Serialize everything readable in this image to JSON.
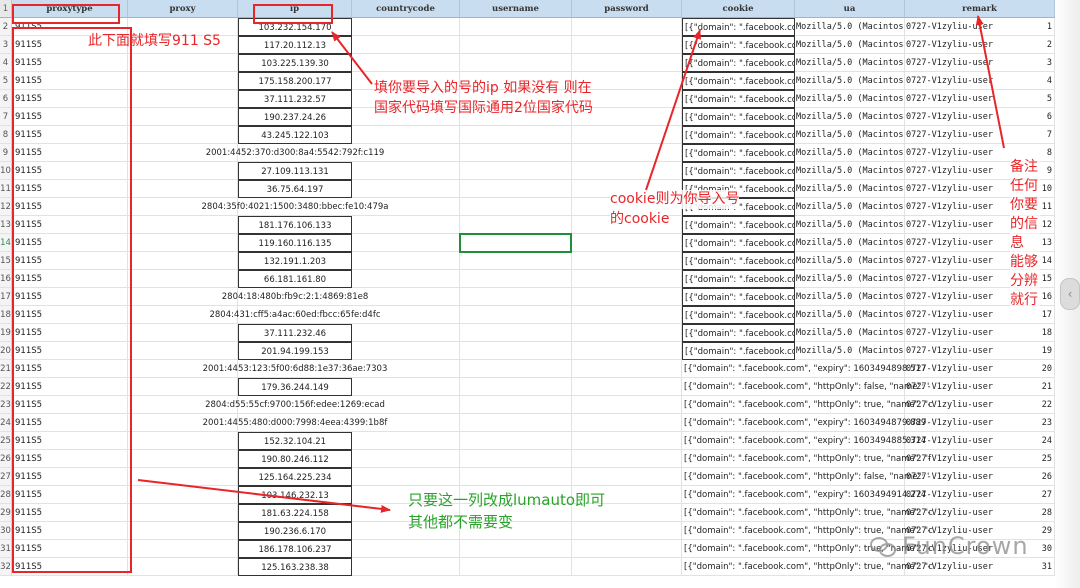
{
  "headers": [
    "proxytype",
    "proxy",
    "ip",
    "countrycode",
    "username",
    "password",
    "cookie",
    "ua",
    "remark"
  ],
  "rows": [
    {
      "proxytype": "911S5",
      "ip": "103.232.154.170",
      "cookie": "[{\"domain\": \".facebook.com\",",
      "ua": "Mozilla/5.0 (Macintos",
      "remark": "0727-V1zyliu-user",
      "remark_num": "1"
    },
    {
      "proxytype": "911S5",
      "ip": "117.20.112.13",
      "cookie": "[{\"domain\": \".facebook.com\",",
      "ua": "Mozilla/5.0 (Macintos",
      "remark": "0727-V1zyliu-user",
      "remark_num": "2"
    },
    {
      "proxytype": "911S5",
      "ip": "103.225.139.30",
      "cookie": "[{\"domain\": \".facebook.com\",",
      "ua": "Mozilla/5.0 (Macintos",
      "remark": "0727-V1zyliu-user",
      "remark_num": "3"
    },
    {
      "proxytype": "911S5",
      "ip": "175.158.200.177",
      "cookie": "[{\"domain\": \".facebook.com\",",
      "ua": "Mozilla/5.0 (Macintos",
      "remark": "0727-V1zyliu-user",
      "remark_num": "4"
    },
    {
      "proxytype": "911S5",
      "ip": "37.111.232.57",
      "cookie": "[{\"domain\": \".facebook.com\",",
      "ua": "Mozilla/5.0 (Macintos",
      "remark": "0727-V1zyliu-user",
      "remark_num": "5"
    },
    {
      "proxytype": "911S5",
      "ip": "190.237.24.26",
      "cookie": "[{\"domain\": \".facebook.com\",",
      "ua": "Mozilla/5.0 (Macintos",
      "remark": "0727-V1zyliu-user",
      "remark_num": "6"
    },
    {
      "proxytype": "911S5",
      "ip": "43.245.122.103",
      "cookie": "[{\"domain\": \".facebook.com\",",
      "ua": "Mozilla/5.0 (Macintos",
      "remark": "0727-V1zyliu-user",
      "remark_num": "7"
    },
    {
      "proxytype": "911S5",
      "ip": "2001:4452:370:d300:8a4:5542:792f:c119",
      "cookie": "[{\"domain\": \".facebook.com\",",
      "ua": "Mozilla/5.0 (Macintos",
      "remark": "0727-V1zyliu-user",
      "remark_num": "8"
    },
    {
      "proxytype": "911S5",
      "ip": "27.109.113.131",
      "cookie": "[{\"domain\": \".facebook.com\",",
      "ua": "Mozilla/5.0 (Macintos",
      "remark": "0727-V1zyliu-user",
      "remark_num": "9"
    },
    {
      "proxytype": "911S5",
      "ip": "36.75.64.197",
      "cookie": "[{\"domain\": \".facebook.com\",",
      "ua": "Mozilla/5.0 (Macintos",
      "remark": "0727-V1zyliu-user",
      "remark_num": "10"
    },
    {
      "proxytype": "911S5",
      "ip": "2804:35f0:4021:1500:3480:bbec:fe10:479a",
      "cookie": "[{\"domain\": \".facebook.com\",",
      "ua": "Mozilla/5.0 (Macintos",
      "remark": "0727-V1zyliu-user",
      "remark_num": "11"
    },
    {
      "proxytype": "911S5",
      "ip": "181.176.106.133",
      "cookie": "[{\"domain\": \".facebook.com\",",
      "ua": "Mozilla/5.0 (Macintos",
      "remark": "0727-V1zyliu-user",
      "remark_num": "12"
    },
    {
      "proxytype": "911S5",
      "ip": "119.160.116.135",
      "cookie": "[{\"domain\": \".facebook.com\",",
      "ua": "Mozilla/5.0 (Macintos",
      "remark": "0727-V1zyliu-user",
      "remark_num": "13"
    },
    {
      "proxytype": "911S5",
      "ip": "132.191.1.203",
      "cookie": "[{\"domain\": \".facebook.com\",",
      "ua": "Mozilla/5.0 (Macintos",
      "remark": "0727-V1zyliu-user",
      "remark_num": "14"
    },
    {
      "proxytype": "911S5",
      "ip": "66.181.161.80",
      "cookie": "[{\"domain\": \".facebook.com\",",
      "ua": "Mozilla/5.0 (Macintos",
      "remark": "0727-V1zyliu-user",
      "remark_num": "15"
    },
    {
      "proxytype": "911S5",
      "ip": "2804:18:480b:fb9c:2:1:4869:81e8",
      "cookie": "[{\"domain\": \".facebook.com\",",
      "ua": "Mozilla/5.0 (Macintos",
      "remark": "0727-V1zyliu-user",
      "remark_num": "16"
    },
    {
      "proxytype": "911S5",
      "ip": "2804:431:cff5:a4ac:60ed:fbcc:65fe:d4fc",
      "cookie": "[{\"domain\": \".facebook.com\",",
      "ua": "Mozilla/5.0 (Macintos",
      "remark": "0727-V1zyliu-user",
      "remark_num": "17"
    },
    {
      "proxytype": "911S5",
      "ip": "37.111.232.46",
      "cookie": "[{\"domain\": \".facebook.com\",",
      "ua": "Mozilla/5.0 (Macintos",
      "remark": "0727-V1zyliu-user",
      "remark_num": "18"
    },
    {
      "proxytype": "911S5",
      "ip": "201.94.199.153",
      "cookie": "[{\"domain\": \".facebook.com\",",
      "ua": "Mozilla/5.0 (Macintos",
      "remark": "0727-V1zyliu-user",
      "remark_num": "19"
    },
    {
      "proxytype": "911S5",
      "ip": "2001:4453:123:5f00:6d88:1e37:36ae:7303",
      "cookie": "[{\"domain\": \".facebook.com\", \"expiry\": 1603494898.517",
      "ua": "",
      "remark": "0727-V1zyliu-user",
      "remark_num": "20"
    },
    {
      "proxytype": "911S5",
      "ip": "179.36.244.149",
      "cookie": "[{\"domain\": \".facebook.com\", \"httpOnly\": false, \"name\": '",
      "ua": "",
      "remark": "0727-V1zyliu-user",
      "remark_num": "21"
    },
    {
      "proxytype": "911S5",
      "ip": "2804:d55:55cf:9700:156f:edee:1269:ecad",
      "cookie": "[{\"domain\": \".facebook.com\", \"httpOnly\": true, \"name\": \"c",
      "ua": "",
      "remark": "0727-V1zyliu-user",
      "remark_num": "22"
    },
    {
      "proxytype": "911S5",
      "ip": "2001:4455:480:d000:7998:4eea:4399:1b8f",
      "cookie": "[{\"domain\": \".facebook.com\", \"expiry\": 1603494879.889",
      "ua": "",
      "remark": "0727-V1zyliu-user",
      "remark_num": "23"
    },
    {
      "proxytype": "911S5",
      "ip": "152.32.104.21",
      "cookie": "[{\"domain\": \".facebook.com\", \"expiry\": 1603494885.314",
      "ua": "",
      "remark": "0727-V1zyliu-user",
      "remark_num": "24"
    },
    {
      "proxytype": "911S5",
      "ip": "190.80.246.112",
      "cookie": "[{\"domain\": \".facebook.com\", \"httpOnly\": true, \"name\": \"f",
      "ua": "",
      "remark": "0727-V1zyliu-user",
      "remark_num": "25"
    },
    {
      "proxytype": "911S5",
      "ip": "125.164.225.234",
      "cookie": "[{\"domain\": \".facebook.com\", \"httpOnly\": false, \"name\": '",
      "ua": "",
      "remark": "0727-V1zyliu-user",
      "remark_num": "26"
    },
    {
      "proxytype": "911S5",
      "ip": "103.146.232.13",
      "cookie": "[{\"domain\": \".facebook.com\", \"expiry\": 1603494914.274",
      "ua": "",
      "remark": "0727-V1zyliu-user",
      "remark_num": "27"
    },
    {
      "proxytype": "911S5",
      "ip": "181.63.224.158",
      "cookie": "[{\"domain\": \".facebook.com\", \"httpOnly\": true, \"name\": \"c",
      "ua": "",
      "remark": "0727-V1zyliu-user",
      "remark_num": "28"
    },
    {
      "proxytype": "911S5",
      "ip": "190.236.6.170",
      "cookie": "[{\"domain\": \".facebook.com\", \"httpOnly\": true, \"name\": \"c",
      "ua": "",
      "remark": "0727-V1zyliu-user",
      "remark_num": "29"
    },
    {
      "proxytype": "911S5",
      "ip": "186.178.106.237",
      "cookie": "[{\"domain\": \".facebook.com\", \"httpOnly\": true, \"name\": \"c",
      "ua": "",
      "remark": "0727-V1zyliu-user",
      "remark_num": "30"
    },
    {
      "proxytype": "911S5",
      "ip": "125.163.238.38",
      "cookie": "[{\"domain\": \".facebook.com\", \"httpOnly\": true, \"name\": \"c",
      "ua": "",
      "remark": "0727-V1zyliu-user",
      "remark_num": "31"
    }
  ],
  "annotations": {
    "proxytype_note": "此下面就填写911 S5",
    "ip_note_line1": "填你要导入的号的ip 如果没有 则在",
    "ip_note_line2": "国家代码填写国际通用2位国家代码",
    "cookie_note_line1": "cookie则为你导入号",
    "cookie_note_line2": "的cookie",
    "remark_note": "备注任何你要的信息 能够分辨就行",
    "bottom_note_line1": "只要这一列改成lumauto即可",
    "bottom_note_line2": "其他都不需要变"
  },
  "watermark": "FunCrown",
  "colors": {
    "annotation": "#e8262a",
    "green_note": "#2aa32a",
    "header_bg": "#c9ddf0",
    "selection": "#1f8f3a"
  }
}
